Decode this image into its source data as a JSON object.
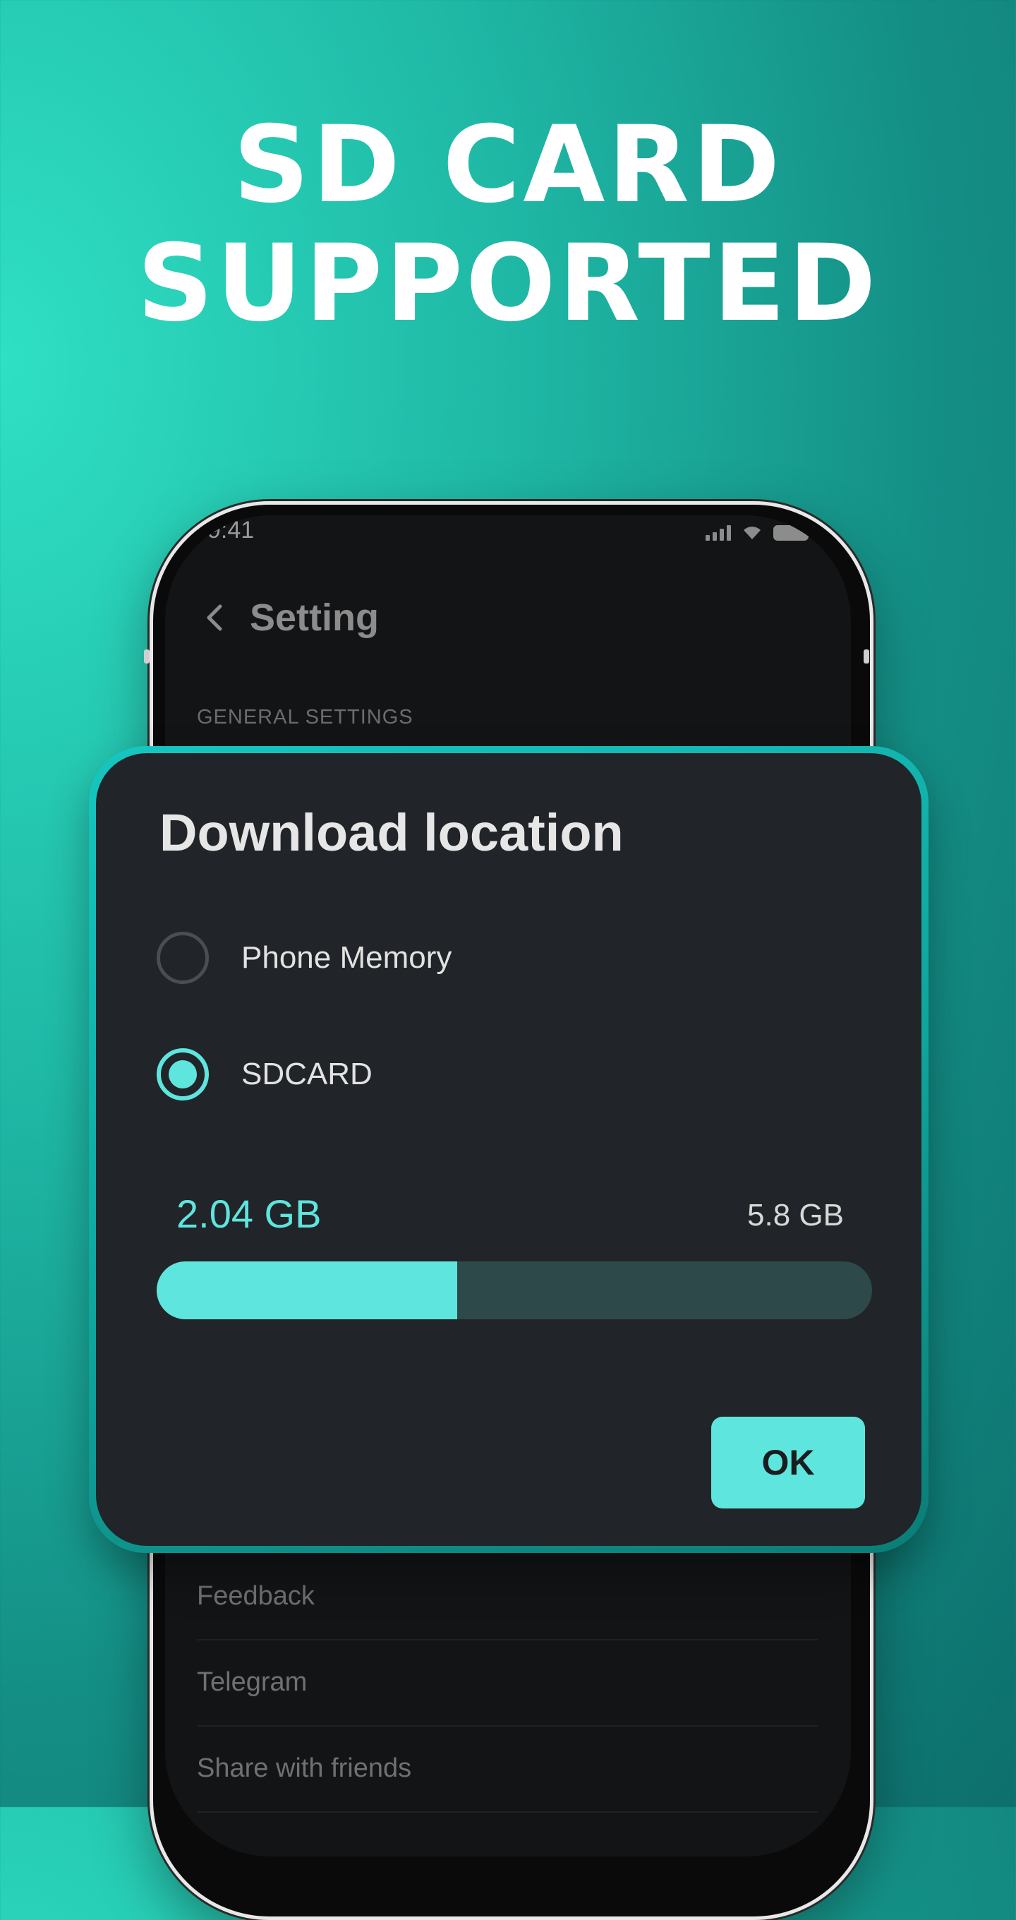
{
  "headline": {
    "line1": "SD CARD",
    "line2": "SUPPORTED"
  },
  "status_bar": {
    "time": "9:41"
  },
  "header": {
    "title": "Setting"
  },
  "settings": {
    "section_label": "GENERAL SETTINGS",
    "items": [
      "Feedback",
      "Telegram",
      "Share with friends"
    ]
  },
  "dialog": {
    "title": "Download location",
    "options": [
      {
        "label": "Phone Memory",
        "selected": false
      },
      {
        "label": "SDCARD",
        "selected": true
      }
    ],
    "storage": {
      "used": "2.04 GB",
      "total": "5.8 GB",
      "used_fraction": 0.42
    },
    "ok_label": "OK"
  },
  "colors": {
    "accent": "#5ee5de",
    "dialog_bg": "#212428",
    "track": "#2e4949",
    "background": "#1fb9a6"
  }
}
